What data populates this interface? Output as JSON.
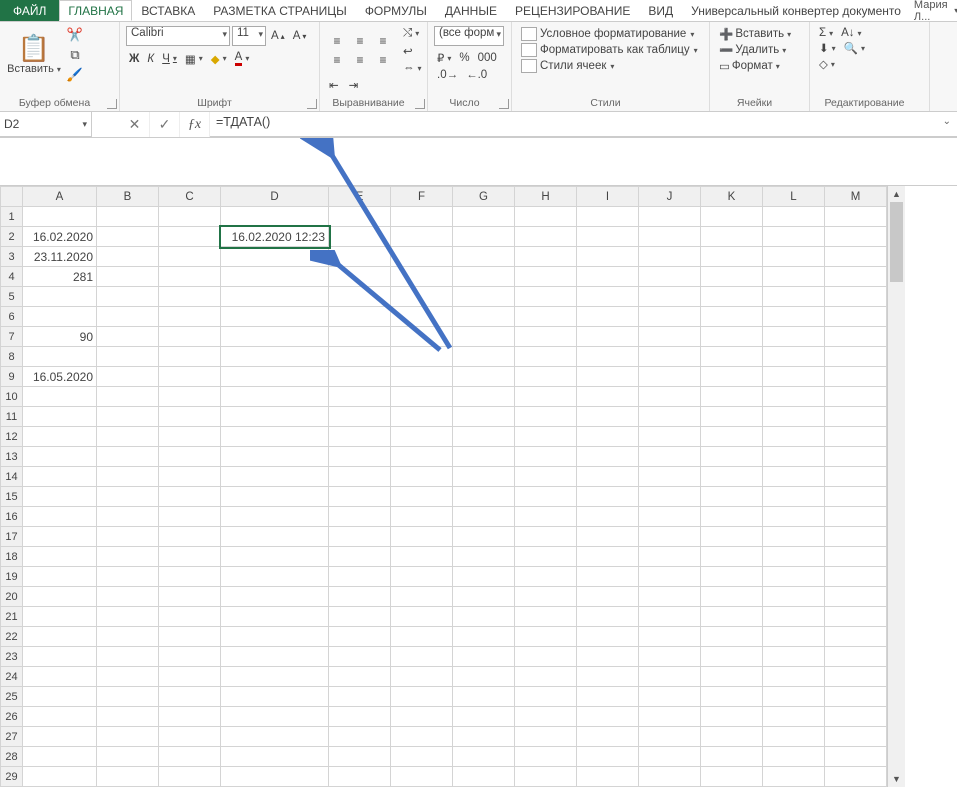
{
  "tabs": {
    "file": "ФАЙЛ",
    "home": "ГЛАВНАЯ",
    "insert": "ВСТАВКА",
    "layout": "РАЗМЕТКА СТРАНИЦЫ",
    "formulas": "ФОРМУЛЫ",
    "data": "ДАННЫЕ",
    "review": "РЕЦЕНЗИРОВАНИЕ",
    "view": "ВИД",
    "converter": "Универсальный конвертер документо"
  },
  "user": "Мария Л...",
  "clipboard": {
    "paste": "Вставить",
    "label": "Буфер обмена"
  },
  "font": {
    "name": "Calibri",
    "size": "11",
    "bold": "Ж",
    "italic": "К",
    "underline": "Ч",
    "label": "Шрифт"
  },
  "alignment": {
    "label": "Выравнивание"
  },
  "number": {
    "format": "(все форм",
    "label": "Число"
  },
  "styles": {
    "conditional": "Условное форматирование",
    "as_table": "Форматировать как таблицу",
    "cell_styles": "Стили ячеек",
    "label": "Стили"
  },
  "cells": {
    "insert": "Вставить",
    "delete": "Удалить",
    "format": "Формат",
    "label": "Ячейки"
  },
  "editing": {
    "label": "Редактирование"
  },
  "name_box": "D2",
  "formula": "=ТДАТА()",
  "columns": [
    "A",
    "B",
    "C",
    "D",
    "E",
    "F",
    "G",
    "H",
    "I",
    "J",
    "K",
    "L",
    "M"
  ],
  "row_count": 29,
  "data_cells": {
    "A2": "16.02.2020",
    "A3": "23.11.2020",
    "A4": "281",
    "A7": "90",
    "A9": "16.05.2020",
    "D2": "16.02.2020 12:23"
  },
  "selected": "D2"
}
